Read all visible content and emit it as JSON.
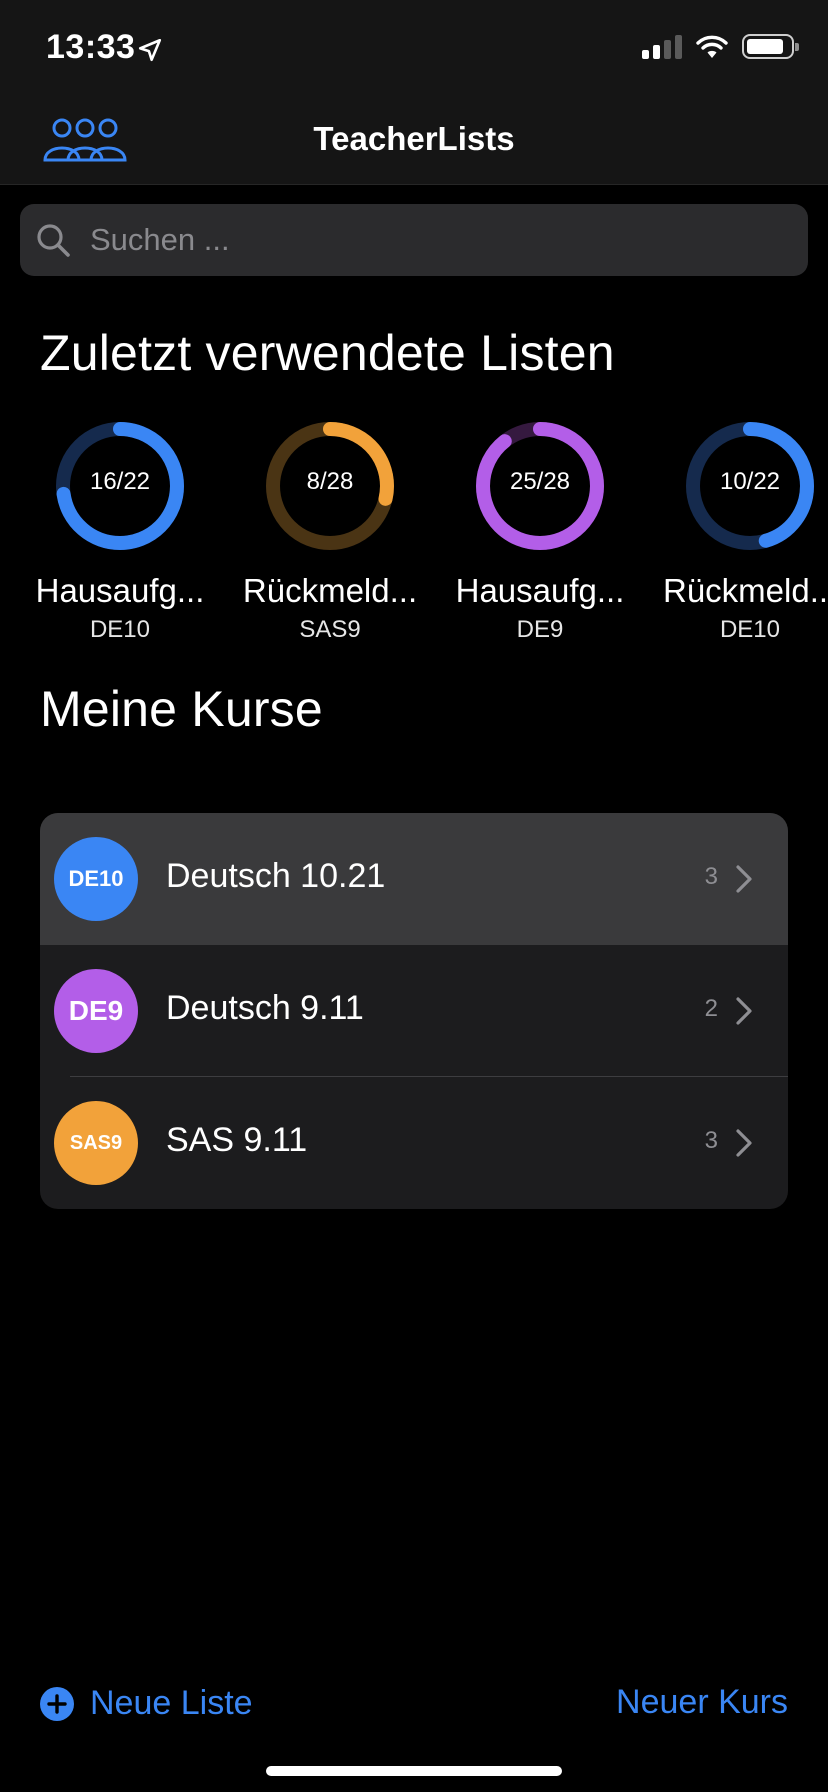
{
  "status_bar": {
    "time": "13:33"
  },
  "nav": {
    "title": "TeacherLists"
  },
  "search": {
    "placeholder": "Suchen ..."
  },
  "recent": {
    "title": "Zuletzt verwendete Listen",
    "items": [
      {
        "label": "16/22",
        "name": "Hausaufg...",
        "course": "DE10",
        "progress": 0.727,
        "color": "#3a86f4",
        "track": "#152a4d"
      },
      {
        "label": "8/28",
        "name": "Rückmeld...",
        "course": "SAS9",
        "progress": 0.286,
        "color": "#f2a23a",
        "track": "#4a3414"
      },
      {
        "label": "25/28",
        "name": "Hausaufg...",
        "course": "DE9",
        "progress": 0.893,
        "color": "#b35ee8",
        "track": "#35193f"
      },
      {
        "label": "10/22",
        "name": "Rückmeld...",
        "course": "DE10",
        "progress": 0.455,
        "color": "#3a86f4",
        "track": "#152a4d"
      }
    ]
  },
  "courses": {
    "title": "Meine Kurse",
    "items": [
      {
        "badge": "DE10",
        "name": "Deutsch 10.21",
        "count": "3",
        "color": "#3a86f4"
      },
      {
        "badge": "DE9",
        "name": "Deutsch 9.11",
        "count": "2",
        "color": "#b35ee8"
      },
      {
        "badge": "SAS9",
        "name": "SAS 9.11",
        "count": "3",
        "color": "#f2a23a"
      }
    ]
  },
  "toolbar": {
    "new_list": "Neue Liste",
    "new_course": "Neuer Kurs"
  },
  "colors": {
    "accent": "#3a86f4"
  }
}
